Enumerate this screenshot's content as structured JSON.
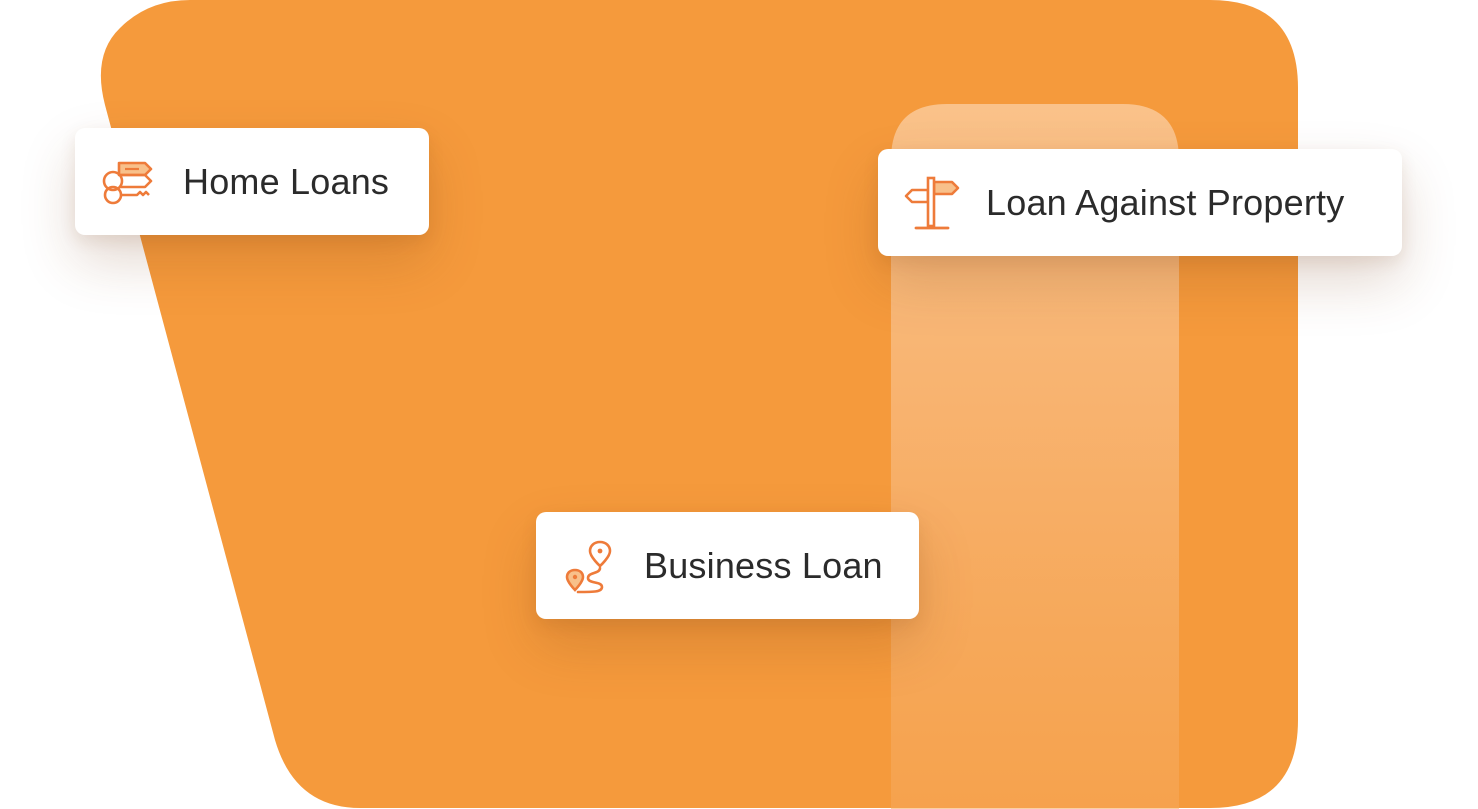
{
  "colors": {
    "primary_orange": "#F59A3C",
    "accent_orange": "#EE7B3A",
    "icon_fill_light": "#F8C08A",
    "highlight_strip": "#F9C089",
    "card_background": "#FFFFFF",
    "text": "#2B2B2B"
  },
  "cards": {
    "home_loans": {
      "label": "Home Loans",
      "icon": "keys-with-tag-icon"
    },
    "loan_against_property": {
      "label": "Loan Against Property",
      "icon": "signpost-icon"
    },
    "business_loan": {
      "label": "Business Loan",
      "icon": "route-map-pin-icon"
    }
  }
}
